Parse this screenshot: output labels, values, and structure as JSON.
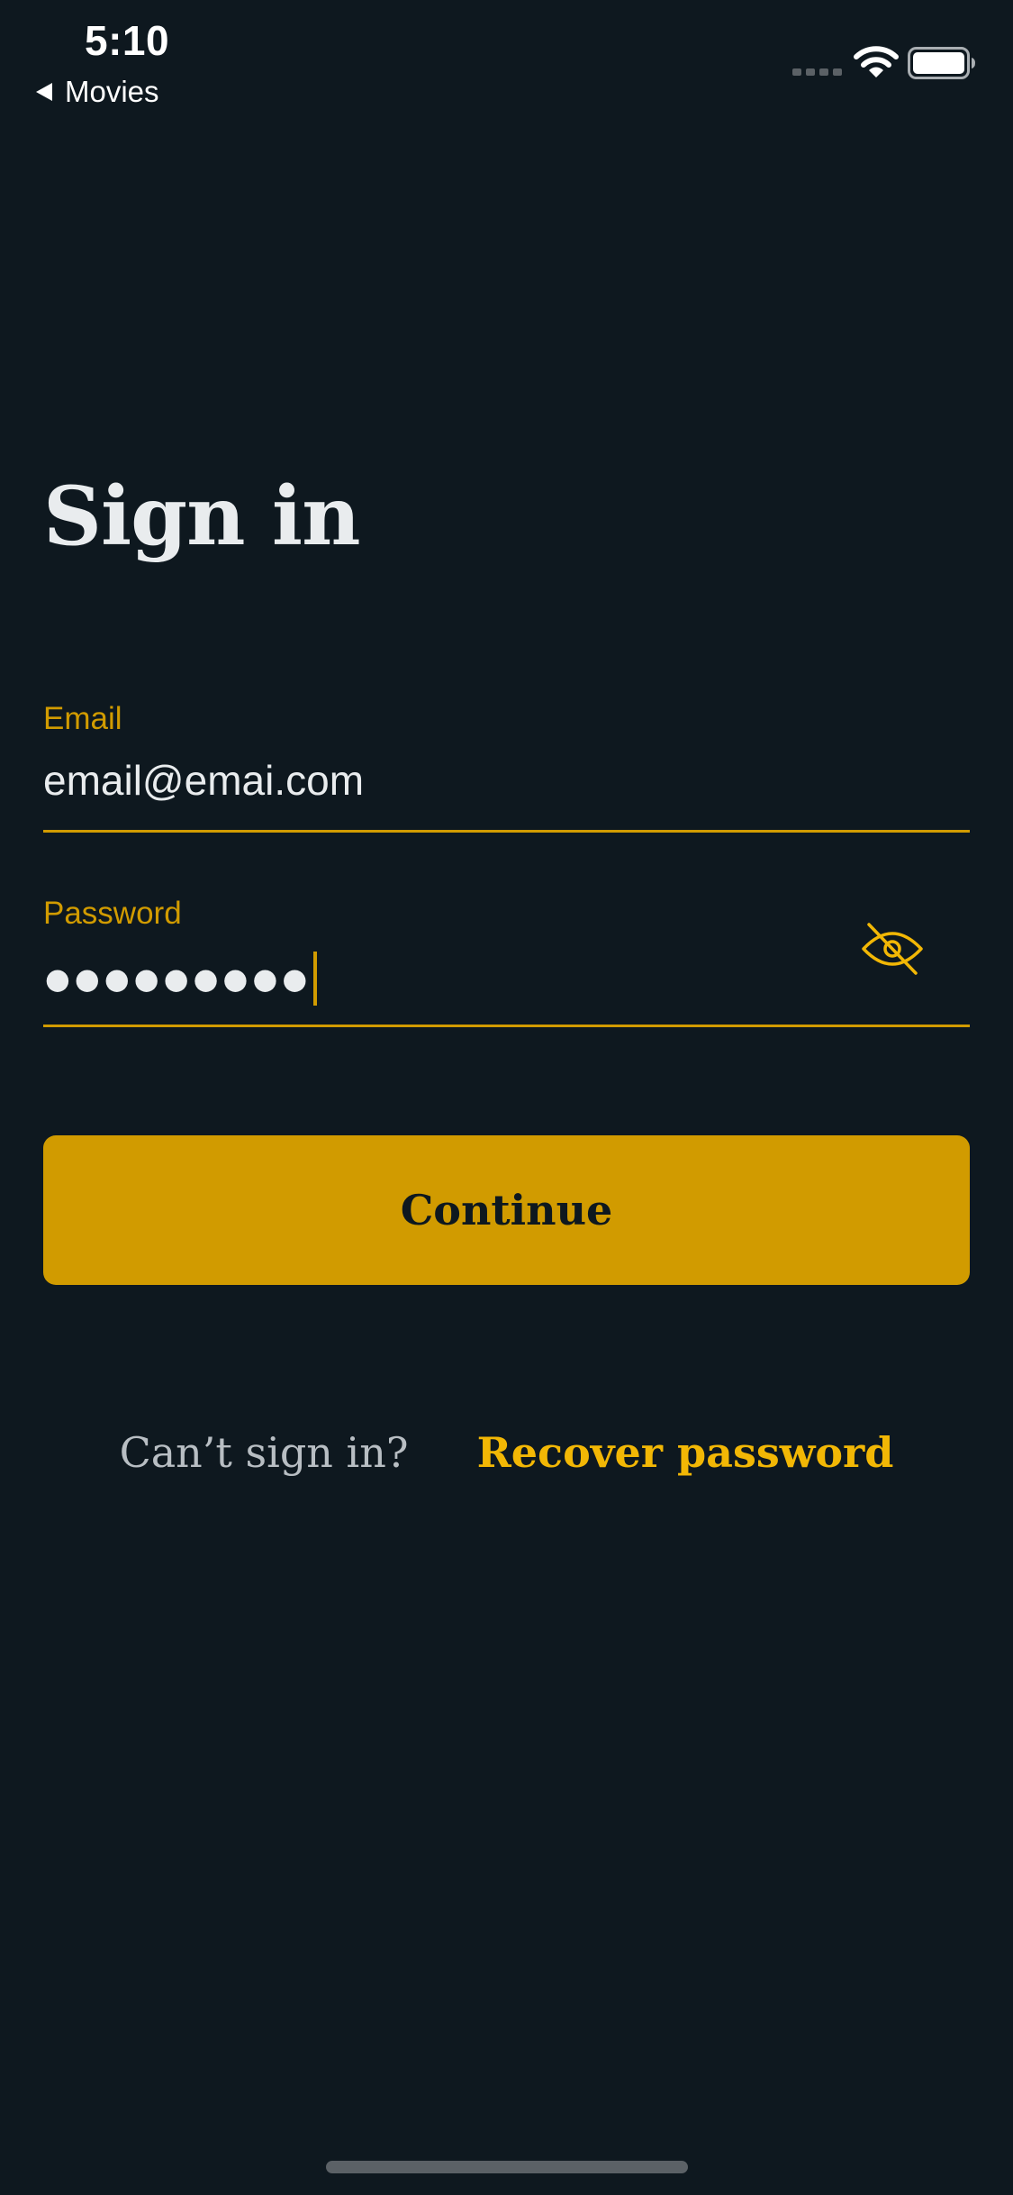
{
  "status_bar": {
    "time": "5:10",
    "back_label": "Movies"
  },
  "page": {
    "title": "Sign in"
  },
  "form": {
    "email": {
      "label": "Email",
      "value": "email@emai.com"
    },
    "password": {
      "label": "Password",
      "masked_value": "●●●●●●●●●",
      "visibility_icon": "eye-off-icon"
    },
    "continue_label": "Continue"
  },
  "help": {
    "prompt": "Can’t sign in?",
    "recover_label": "Recover password"
  },
  "colors": {
    "background": "#0e181f",
    "accent": "#d19b00",
    "link": "#f2b705",
    "text": "#e9ecee",
    "muted_text": "#b8bec3"
  }
}
